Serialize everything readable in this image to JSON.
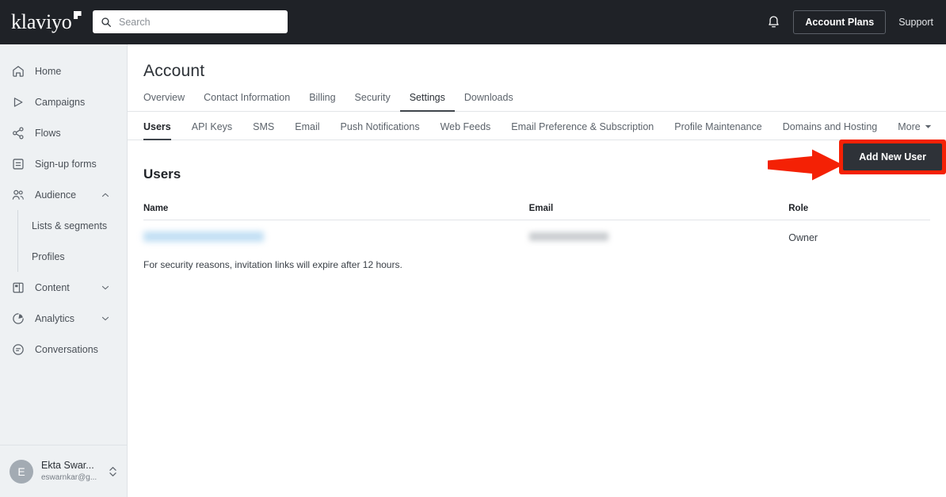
{
  "colors": {
    "topbar_bg": "#1f2227",
    "sidebar_bg": "#eef1f3",
    "accent_highlight": "#f42105",
    "button_bg": "#2e3238",
    "text_primary": "#1f2227",
    "text_muted": "#5c636b"
  },
  "topbar": {
    "brand": "klaviyo",
    "brand_icon": "klaviyo-flag-logo",
    "search": {
      "icon": "search-icon",
      "placeholder": "Search",
      "value": ""
    },
    "bell_icon": "notification-bell-icon",
    "account_plans_label": "Account Plans",
    "support_label": "Support"
  },
  "sidebar": {
    "items": [
      {
        "label": "Home",
        "icon": "home-icon",
        "expandable": false
      },
      {
        "label": "Campaigns",
        "icon": "campaigns-megaphone-icon",
        "expandable": false
      },
      {
        "label": "Flows",
        "icon": "flows-nodes-icon",
        "expandable": false
      },
      {
        "label": "Sign-up forms",
        "icon": "signup-forms-icon",
        "expandable": false
      },
      {
        "label": "Audience",
        "icon": "audience-people-icon",
        "expandable": true,
        "expanded": true
      },
      {
        "label": "Content",
        "icon": "content-document-icon",
        "expandable": true,
        "expanded": false
      },
      {
        "label": "Analytics",
        "icon": "analytics-piechart-icon",
        "expandable": true,
        "expanded": false
      },
      {
        "label": "Conversations",
        "icon": "conversations-chat-icon",
        "expandable": false
      }
    ],
    "audience_subitems": [
      {
        "label": "Lists & segments"
      },
      {
        "label": "Profiles"
      }
    ],
    "profile": {
      "avatar_initial": "E",
      "name": "Ekta Swar...",
      "email": "eswarnkar@g...",
      "switch_icon": "up-down-chevron-icon"
    }
  },
  "main": {
    "page_title": "Account",
    "primary_tabs": [
      {
        "label": "Overview",
        "active": false
      },
      {
        "label": "Contact Information",
        "active": false
      },
      {
        "label": "Billing",
        "active": false
      },
      {
        "label": "Security",
        "active": false
      },
      {
        "label": "Settings",
        "active": true
      },
      {
        "label": "Downloads",
        "active": false
      }
    ],
    "secondary_tabs": [
      {
        "label": "Users",
        "active": true
      },
      {
        "label": "API Keys",
        "active": false
      },
      {
        "label": "SMS",
        "active": false
      },
      {
        "label": "Email",
        "active": false
      },
      {
        "label": "Push Notifications",
        "active": false
      },
      {
        "label": "Web Feeds",
        "active": false
      },
      {
        "label": "Email Preference & Subscription",
        "active": false
      },
      {
        "label": "Profile Maintenance",
        "active": false
      },
      {
        "label": "Domains and Hosting",
        "active": false
      }
    ],
    "more_tab": {
      "label": "More",
      "icon": "chevron-down-icon"
    },
    "section_title": "Users",
    "add_user_label": "Add New User",
    "table": {
      "headers": [
        "Name",
        "Email",
        "Role"
      ],
      "rows": [
        {
          "name": "",
          "email": "",
          "role": "Owner",
          "name_redacted": true,
          "email_redacted": true
        }
      ]
    },
    "note": "For security reasons, invitation links will expire after 12 hours."
  },
  "annotation": {
    "arrow_icon": "red-right-arrow-annotation",
    "highlight_target": "Add New User"
  }
}
